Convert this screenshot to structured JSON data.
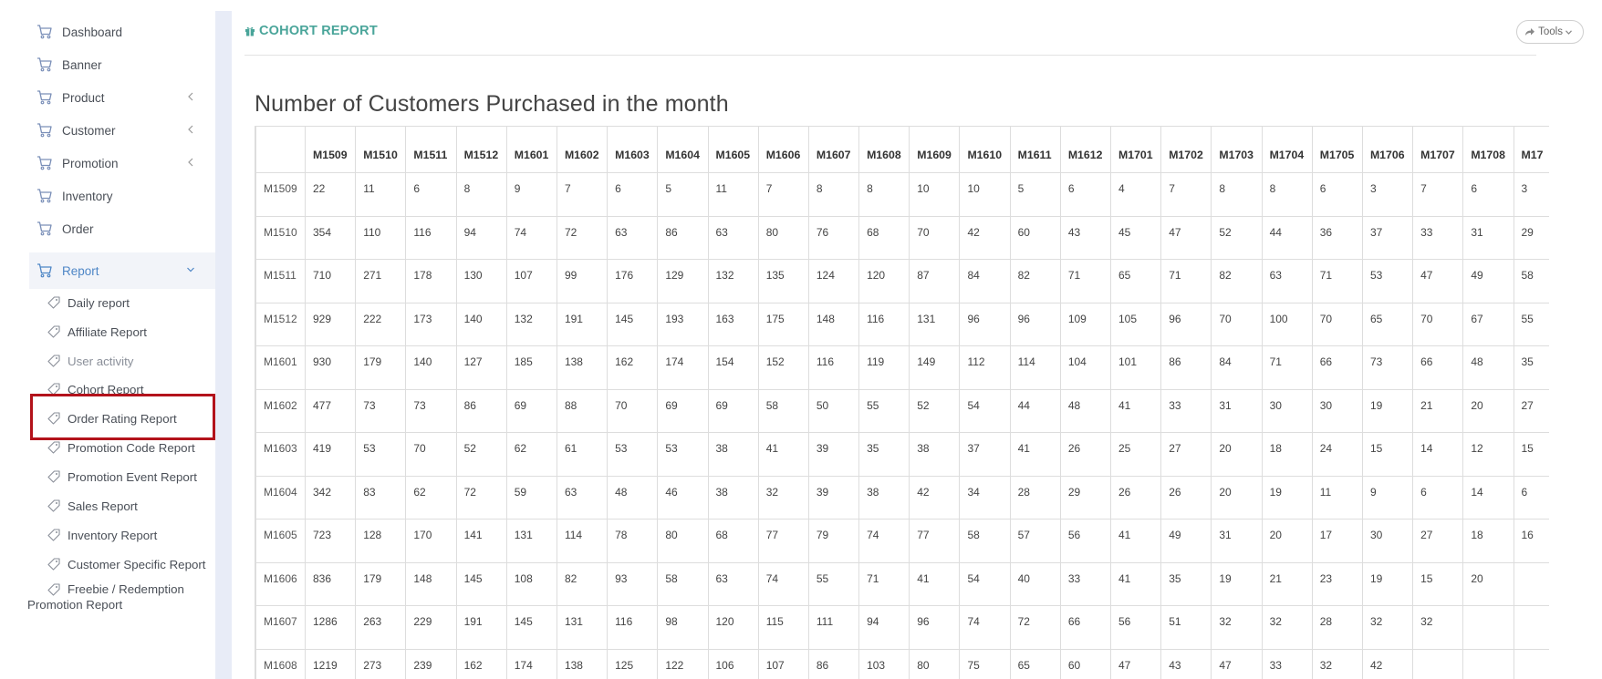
{
  "sidebar": {
    "items": [
      {
        "label": "Dashboard",
        "icon": "cart-icon",
        "expandable": false
      },
      {
        "label": "Banner",
        "icon": "cart-icon",
        "expandable": false
      },
      {
        "label": "Product",
        "icon": "cart-icon",
        "expandable": true
      },
      {
        "label": "Customer",
        "icon": "cart-icon",
        "expandable": true
      },
      {
        "label": "Promotion",
        "icon": "cart-icon",
        "expandable": true
      },
      {
        "label": "Inventory",
        "icon": "cart-icon",
        "expandable": false
      },
      {
        "label": "Order",
        "icon": "cart-icon",
        "expandable": false
      },
      {
        "label": "Report",
        "icon": "cart-icon",
        "expandable": true,
        "expanded": true
      }
    ],
    "report_subitems": [
      {
        "label": "Daily report"
      },
      {
        "label": "Affiliate Report"
      },
      {
        "label": "User activity"
      },
      {
        "label": "Cohort Report",
        "highlighted": true
      },
      {
        "label": "Order Rating Report"
      },
      {
        "label": "Promotion Code Report"
      },
      {
        "label": "Promotion Event Report"
      },
      {
        "label": "Sales Report"
      },
      {
        "label": "Inventory Report"
      },
      {
        "label": "Customer Specific Report"
      },
      {
        "label": "Freebie / Redemption Promotion Report",
        "line1": "Freebie / Redemption",
        "line2": "Promotion Report"
      }
    ]
  },
  "header": {
    "title": "COHORT REPORT",
    "title_icon": "gift-icon",
    "tools_label": "Tools"
  },
  "report": {
    "heading": "Number of Customers Purchased in the month",
    "columns": [
      "M1509",
      "M1510",
      "M1511",
      "M1512",
      "M1601",
      "M1602",
      "M1603",
      "M1604",
      "M1605",
      "M1606",
      "M1607",
      "M1608",
      "M1609",
      "M1610",
      "M1611",
      "M1612",
      "M1701",
      "M1702",
      "M1703",
      "M1704",
      "M1705",
      "M1706",
      "M1707",
      "M1708",
      "M17"
    ],
    "rows": [
      {
        "cohort": "M1509",
        "values": [
          "22",
          "11",
          "6",
          "8",
          "9",
          "7",
          "6",
          "5",
          "11",
          "7",
          "8",
          "8",
          "10",
          "10",
          "5",
          "6",
          "4",
          "7",
          "8",
          "8",
          "6",
          "3",
          "7",
          "6",
          "3"
        ]
      },
      {
        "cohort": "M1510",
        "values": [
          "354",
          "110",
          "116",
          "94",
          "74",
          "72",
          "63",
          "86",
          "63",
          "80",
          "76",
          "68",
          "70",
          "42",
          "60",
          "43",
          "45",
          "47",
          "52",
          "44",
          "36",
          "37",
          "33",
          "31",
          "29"
        ]
      },
      {
        "cohort": "M1511",
        "values": [
          "710",
          "271",
          "178",
          "130",
          "107",
          "99",
          "176",
          "129",
          "132",
          "135",
          "124",
          "120",
          "87",
          "84",
          "82",
          "71",
          "65",
          "71",
          "82",
          "63",
          "71",
          "53",
          "47",
          "49",
          "58"
        ]
      },
      {
        "cohort": "M1512",
        "values": [
          "929",
          "222",
          "173",
          "140",
          "132",
          "191",
          "145",
          "193",
          "163",
          "175",
          "148",
          "116",
          "131",
          "96",
          "96",
          "109",
          "105",
          "96",
          "70",
          "100",
          "70",
          "65",
          "70",
          "67",
          "55"
        ]
      },
      {
        "cohort": "M1601",
        "values": [
          "930",
          "179",
          "140",
          "127",
          "185",
          "138",
          "162",
          "174",
          "154",
          "152",
          "116",
          "119",
          "149",
          "112",
          "114",
          "104",
          "101",
          "86",
          "84",
          "71",
          "66",
          "73",
          "66",
          "48",
          "35"
        ]
      },
      {
        "cohort": "M1602",
        "values": [
          "477",
          "73",
          "73",
          "86",
          "69",
          "88",
          "70",
          "69",
          "69",
          "58",
          "50",
          "55",
          "52",
          "54",
          "44",
          "48",
          "41",
          "33",
          "31",
          "30",
          "30",
          "19",
          "21",
          "20",
          "27"
        ]
      },
      {
        "cohort": "M1603",
        "values": [
          "419",
          "53",
          "70",
          "52",
          "62",
          "61",
          "53",
          "53",
          "38",
          "41",
          "39",
          "35",
          "38",
          "37",
          "41",
          "26",
          "25",
          "27",
          "20",
          "18",
          "24",
          "15",
          "14",
          "12",
          "15"
        ]
      },
      {
        "cohort": "M1604",
        "values": [
          "342",
          "83",
          "62",
          "72",
          "59",
          "63",
          "48",
          "46",
          "38",
          "32",
          "39",
          "38",
          "42",
          "34",
          "28",
          "29",
          "26",
          "26",
          "20",
          "19",
          "11",
          "9",
          "6",
          "14",
          "6"
        ]
      },
      {
        "cohort": "M1605",
        "values": [
          "723",
          "128",
          "170",
          "141",
          "131",
          "114",
          "78",
          "80",
          "68",
          "77",
          "79",
          "74",
          "77",
          "58",
          "57",
          "56",
          "41",
          "49",
          "31",
          "20",
          "17",
          "30",
          "27",
          "18",
          "16"
        ]
      },
      {
        "cohort": "M1606",
        "values": [
          "836",
          "179",
          "148",
          "145",
          "108",
          "82",
          "93",
          "58",
          "63",
          "74",
          "55",
          "71",
          "41",
          "54",
          "40",
          "33",
          "41",
          "35",
          "19",
          "21",
          "23",
          "19",
          "15",
          "20",
          ""
        ]
      },
      {
        "cohort": "M1607",
        "values": [
          "1286",
          "263",
          "229",
          "191",
          "145",
          "131",
          "116",
          "98",
          "120",
          "115",
          "111",
          "94",
          "96",
          "74",
          "72",
          "66",
          "56",
          "51",
          "32",
          "32",
          "28",
          "32",
          "32",
          "",
          ""
        ]
      },
      {
        "cohort": "M1608",
        "values": [
          "1219",
          "273",
          "239",
          "162",
          "174",
          "138",
          "125",
          "122",
          "106",
          "107",
          "86",
          "103",
          "80",
          "75",
          "65",
          "60",
          "47",
          "43",
          "47",
          "33",
          "32",
          "42",
          "",
          "",
          ""
        ]
      }
    ]
  },
  "colors": {
    "accent_teal": "#4aa59a",
    "active_blue": "#4e86c6",
    "highlight_red": "#b3121b",
    "sidebar_rail": "#e8ecf7"
  }
}
